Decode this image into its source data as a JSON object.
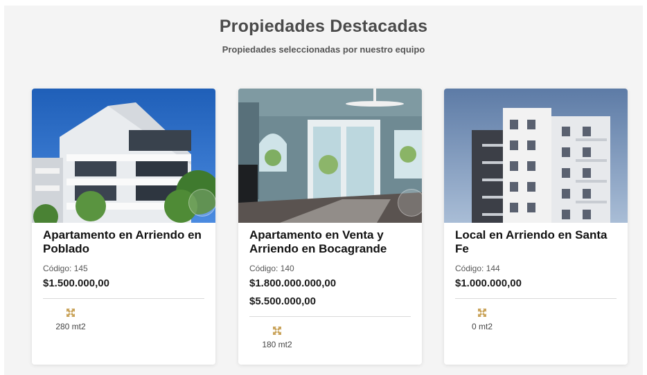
{
  "section": {
    "title": "Propiedades Destacadas",
    "subtitle": "Propiedades seleccionadas por nuestro equipo"
  },
  "properties": [
    {
      "name": "Apartamento en Arriendo en Poblado",
      "code": "Código: 145",
      "prices": [
        "$1.500.000,00"
      ],
      "area": "280 mt2",
      "area_icon": "expand-arrows-icon"
    },
    {
      "name": "Apartamento en Venta y Arriendo en Bocagrande",
      "code": "Código: 140",
      "prices": [
        "$1.800.000.000,00",
        "$5.500.000,00"
      ],
      "area": "180 mt2",
      "area_icon": "expand-arrows-icon"
    },
    {
      "name": "Local en Arriendo en Santa Fe",
      "code": "Código: 144",
      "prices": [
        "$1.000.000,00"
      ],
      "area": "0 mt2",
      "area_icon": "expand-arrows-icon"
    }
  ],
  "colors": {
    "background": "#f4f4f4",
    "card": "#ffffff",
    "icon_gold": "#c9a35a",
    "title": "#4a4a4a"
  }
}
